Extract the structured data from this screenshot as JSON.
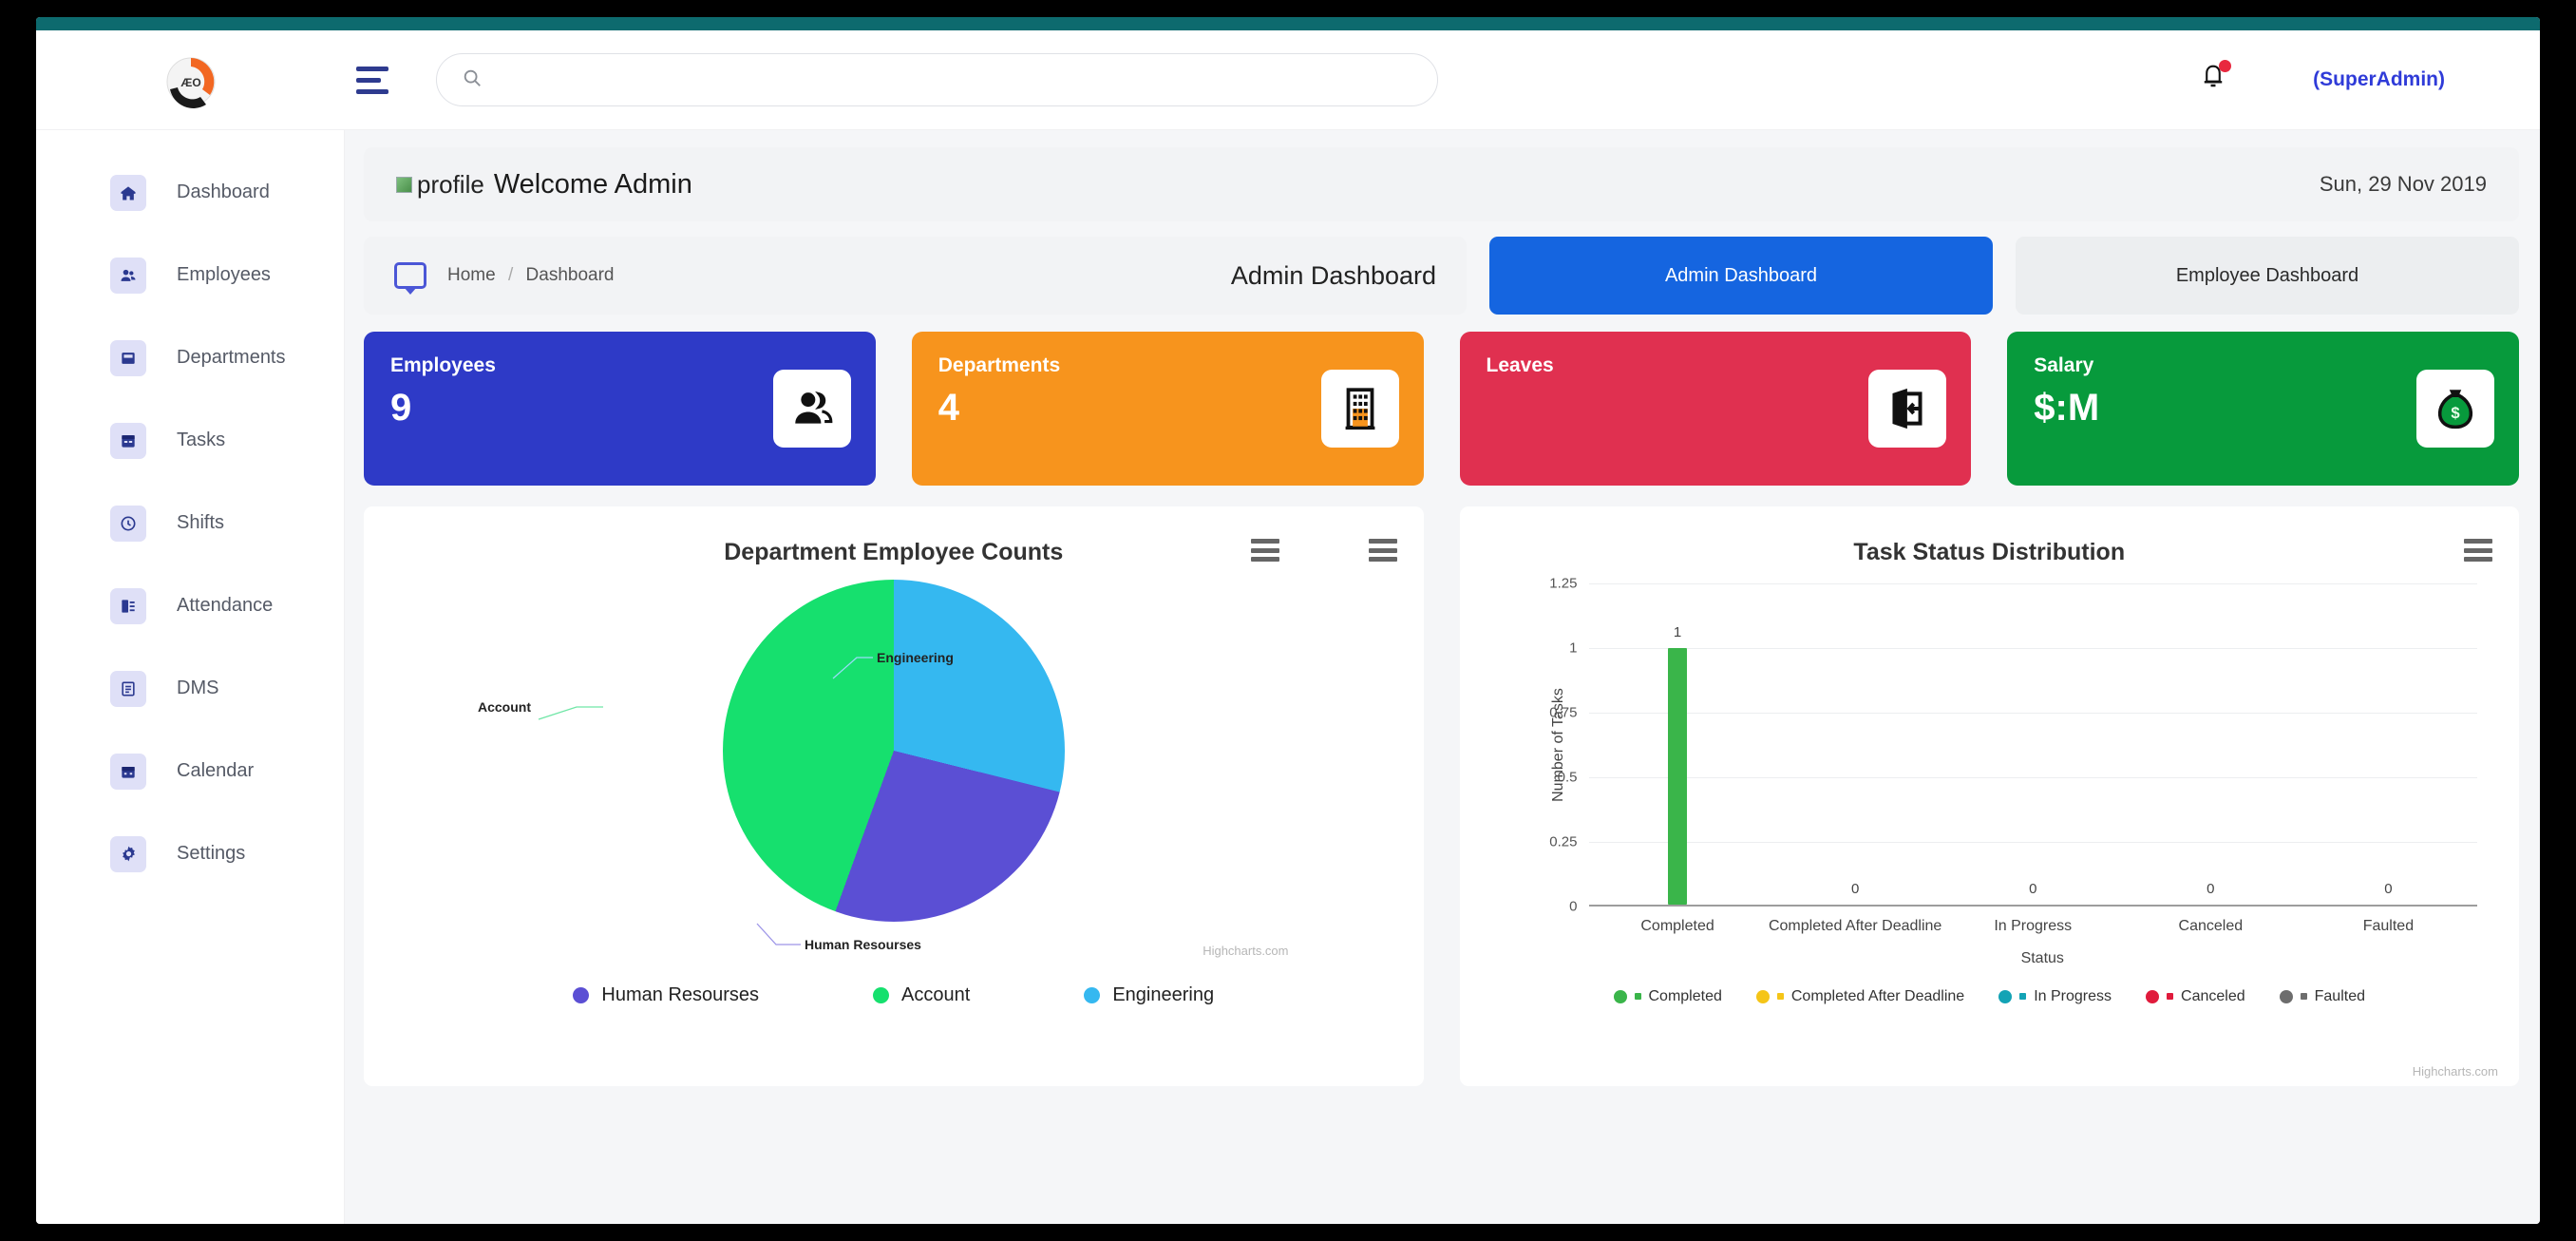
{
  "brand": {
    "logo_text": "ÆO"
  },
  "topbar": {
    "search_placeholder": "",
    "search_value": "",
    "user_label": "(SuperAdmin)",
    "menu_icon": "hamburger-icon",
    "search_icon": "search-icon",
    "bell_icon": "bell-icon"
  },
  "sidebar": {
    "items": [
      {
        "label": "Dashboard",
        "icon": "home-icon"
      },
      {
        "label": "Employees",
        "icon": "users-icon"
      },
      {
        "label": "Departments",
        "icon": "building-icon"
      },
      {
        "label": "Tasks",
        "icon": "clipboard-icon"
      },
      {
        "label": "Shifts",
        "icon": "clock-icon"
      },
      {
        "label": "Attendance",
        "icon": "checklist-icon"
      },
      {
        "label": "DMS",
        "icon": "document-icon"
      },
      {
        "label": "Calendar",
        "icon": "calendar-icon"
      },
      {
        "label": "Settings",
        "icon": "gear-icon"
      }
    ]
  },
  "welcome": {
    "image_alt": "profile",
    "title": "Welcome Admin",
    "date": "Sun, 29 Nov 2019"
  },
  "breadcrumb": {
    "home": "Home",
    "separator": "/",
    "current": "Dashboard",
    "page_title": "Admin Dashboard",
    "icon": "monitor-icon"
  },
  "dashboard_tabs": {
    "admin": "Admin Dashboard",
    "employee": "Employee Dashboard",
    "active": "admin"
  },
  "stats": [
    {
      "label": "Employees",
      "value": "9",
      "color": "#2e3ac7",
      "icon": "users-icon"
    },
    {
      "label": "Departments",
      "value": "4",
      "color": "#f7941d",
      "icon": "office-building-icon"
    },
    {
      "label": "Leaves",
      "value": "",
      "color": "#e03050",
      "icon": "exit-door-icon"
    },
    {
      "label": "Salary",
      "value": "$:M",
      "color": "#079a3c",
      "icon": "money-bag-icon"
    }
  ],
  "chart_data": [
    {
      "type": "pie",
      "title": "Department Employee Counts",
      "credit": "Highcharts.com",
      "categories": [
        "Human Resourses",
        "Account",
        "Engineering"
      ],
      "values": [
        27,
        44,
        29
      ],
      "colors": [
        "#5b4fd4",
        "#16e06e",
        "#35b8f0"
      ],
      "slice_labels": [
        "Human Resourses",
        "Account",
        "Engineering"
      ],
      "legend_position": "bottom",
      "legend": [
        "Human Resourses",
        "Account",
        "Engineering"
      ]
    },
    {
      "type": "bar",
      "title": "Task Status Distribution",
      "credit": "Highcharts.com",
      "categories": [
        "Completed",
        "Completed After Deadline",
        "In Progress",
        "Canceled",
        "Faulted"
      ],
      "values": [
        1,
        0,
        0,
        0,
        0
      ],
      "colors": [
        "#3ab54a",
        "#f5c518",
        "#13a3b5",
        "#e01b3c",
        "#6d6d6d"
      ],
      "data_labels": [
        "1",
        "0",
        "0",
        "0",
        "0"
      ],
      "xlabel": "Status",
      "ylabel": "Number of Tasks",
      "ylim": [
        0,
        1.25
      ],
      "yticks": [
        "0",
        "0.25",
        "0.5",
        "0.75",
        "1",
        "1.25"
      ],
      "grid": true,
      "legend_position": "bottom",
      "legend": [
        "Completed",
        "Completed After Deadline",
        "In Progress",
        "Canceled",
        "Faulted"
      ]
    }
  ]
}
